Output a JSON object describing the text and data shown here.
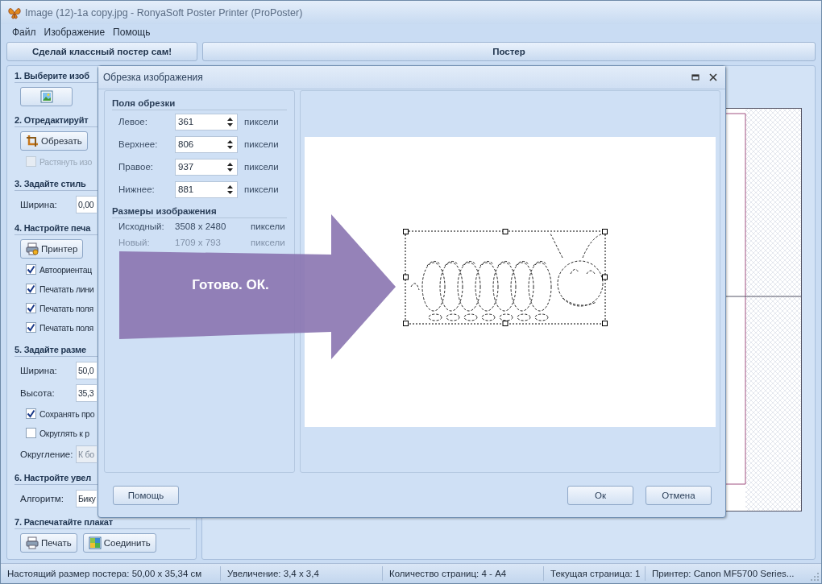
{
  "window": {
    "title": "Image (12)-1a copy.jpg - RonyaSoft Poster Printer (ProPoster)"
  },
  "menu": [
    "Файл",
    "Изображение",
    "Помощь"
  ],
  "panel_headers": [
    "Сделай классный постер сам!",
    "Постер"
  ],
  "left_panel": {
    "sections": [
      {
        "heading": "1. Выберите изоб",
        "items": [
          {
            "kind": "button"
          }
        ]
      },
      {
        "heading": "2. Отредактируйт",
        "items": [
          {
            "kind": "button",
            "label": "Обрезать"
          },
          {
            "kind": "checkbox",
            "label": "Растянуть изо",
            "checked": false,
            "disabled": true
          }
        ]
      },
      {
        "heading": "3. Задайте стиль",
        "items": [
          {
            "kind": "field",
            "label": "Ширина:",
            "value": "0,00",
            "disabled": false
          }
        ]
      },
      {
        "heading": "4. Настройте печа",
        "items": [
          {
            "kind": "button",
            "label": "Принтер"
          },
          {
            "kind": "checkbox",
            "label": "Автоориентац",
            "checked": true,
            "disabled": false
          },
          {
            "kind": "checkbox",
            "label": "Печатать лини",
            "checked": true,
            "disabled": false
          },
          {
            "kind": "checkbox",
            "label": "Печатать поля",
            "checked": true,
            "disabled": false
          },
          {
            "kind": "checkbox",
            "label": "Печатать поля",
            "checked": true,
            "disabled": false
          }
        ]
      },
      {
        "heading": "5. Задайте разме",
        "items": [
          {
            "kind": "field",
            "label": "Ширина:",
            "value": "50,0",
            "disabled": false
          },
          {
            "kind": "field",
            "label": "Высота:",
            "value": "35,3",
            "disabled": false
          },
          {
            "kind": "checkbox",
            "label": "Сохранять про",
            "checked": true,
            "disabled": false
          },
          {
            "kind": "checkbox",
            "label": "Округлять к р",
            "checked": false,
            "disabled": false
          },
          {
            "kind": "field",
            "label": "Округление:",
            "value": "К бо",
            "disabled": true
          }
        ]
      },
      {
        "heading": "6. Настройте увел",
        "items": [
          {
            "kind": "field",
            "label": "Алгоритм:",
            "value": "Бику",
            "disabled": false
          }
        ]
      },
      {
        "heading": "7. Распечатайте плакат",
        "items": [
          {
            "kind": "button",
            "label": "Печать"
          },
          {
            "kind": "button",
            "label": "Соединить"
          }
        ]
      }
    ]
  },
  "crop_dialog": {
    "title": "Обрезка изображения",
    "crop_margins": {
      "heading": "Поля обрезки",
      "rows": [
        {
          "label": "Левое:",
          "value": "361",
          "unit": "пиксели"
        },
        {
          "label": "Верхнее:",
          "value": "806",
          "unit": "пиксели"
        },
        {
          "label": "Правое:",
          "value": "937",
          "unit": "пиксели"
        },
        {
          "label": "Нижнее:",
          "value": "881",
          "unit": "пиксели"
        }
      ]
    },
    "image_sizes": {
      "heading": "Размеры изображения",
      "rows": [
        {
          "label": "Исходный:",
          "value": "3508 x 2480",
          "unit": "пиксели",
          "disabled": false
        },
        {
          "label": "Новый:",
          "value": "1709 x 793",
          "unit": "пиксели",
          "disabled": true
        }
      ]
    },
    "help_button": "Помощь",
    "buttons": [
      "Ок",
      "Отмена"
    ]
  },
  "annotation": {
    "text": "Готово. ОК."
  },
  "status_bar": [
    "Настоящий размер постера: 50,00 x 35,34 см",
    "Увеличение: 3,4 x 3,4",
    "Количество страниц: 4 - A4",
    "Текущая страница: 1",
    "Принтер: Canon MF5700 Series..."
  ]
}
